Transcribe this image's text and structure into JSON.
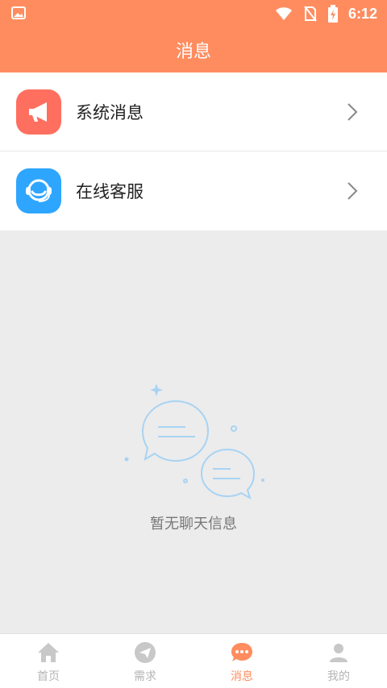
{
  "status_bar": {
    "time": "6:12"
  },
  "header": {
    "title": "消息"
  },
  "menu": {
    "items": [
      {
        "label": "系统消息",
        "icon": "megaphone-icon"
      },
      {
        "label": "在线客服",
        "icon": "headset-icon"
      }
    ]
  },
  "empty_state": {
    "text": "暂无聊天信息",
    "icon": "chat-bubbles-icon"
  },
  "tabbar": {
    "items": [
      {
        "label": "首页",
        "icon": "home-icon",
        "active": false
      },
      {
        "label": "需求",
        "icon": "paper-plane-icon",
        "active": false
      },
      {
        "label": "消息",
        "icon": "message-icon",
        "active": true
      },
      {
        "label": "我的",
        "icon": "user-icon",
        "active": false
      }
    ]
  },
  "colors": {
    "accent": "#ff8c5f",
    "system_icon_bg": "#ff6f5f",
    "service_icon_bg": "#2ea6ff",
    "inactive_tab": "#b4b4b4",
    "empty_bg": "#ececec"
  }
}
